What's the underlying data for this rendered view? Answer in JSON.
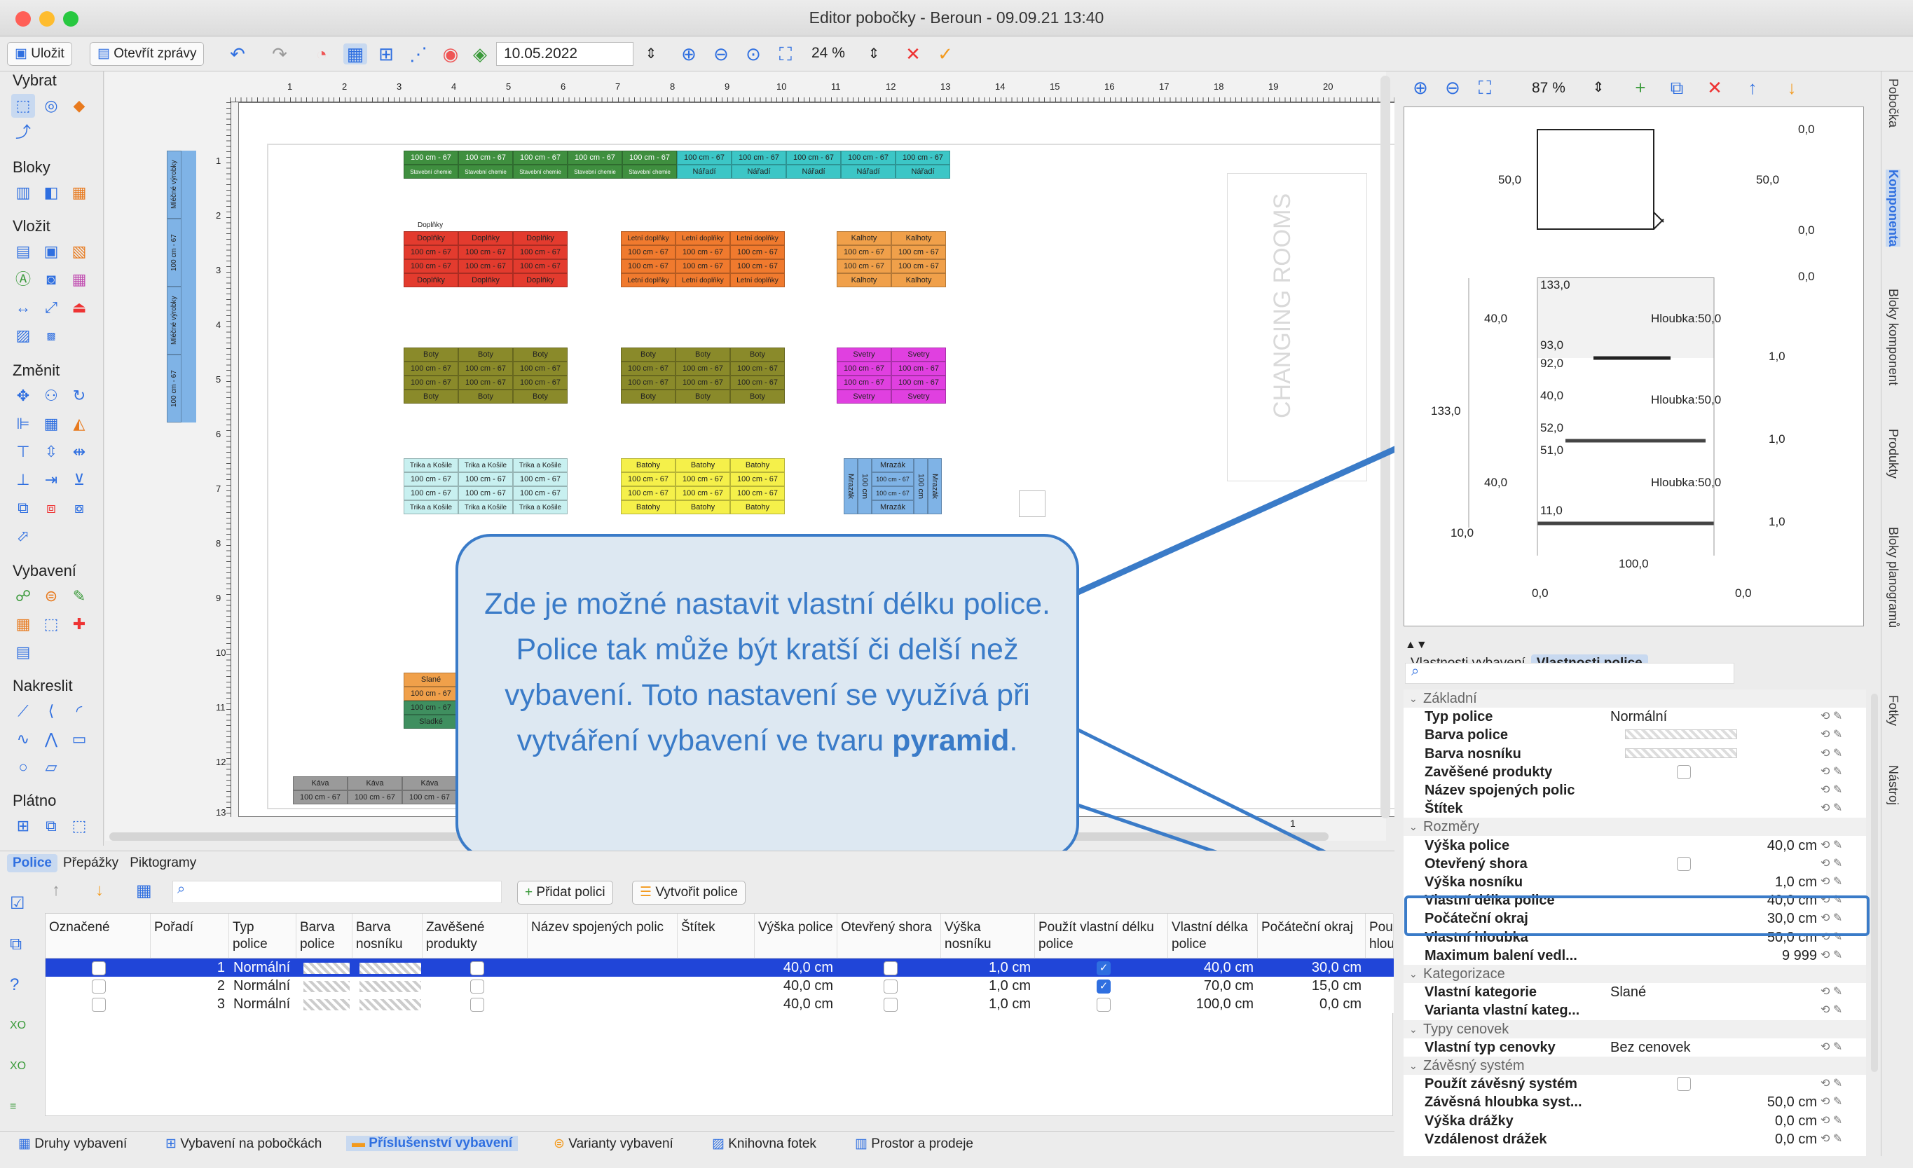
{
  "window": {
    "title": "Editor pobočky - Beroun - 09.09.21 13:40"
  },
  "toolbar": {
    "save_label": "Uložit",
    "open_reports_label": "Otevřít zprávy",
    "date": "10.05.2022",
    "zoom": "24 %"
  },
  "palette": {
    "sections": [
      "Vybrat",
      "Bloky",
      "Vložit",
      "Změnit",
      "Vybavení",
      "Nakreslit",
      "Plátno"
    ]
  },
  "canvas": {
    "ruler_top": [
      "1",
      "2",
      "3",
      "4",
      "5",
      "6",
      "7",
      "8",
      "9",
      "10",
      "11",
      "12",
      "13",
      "14",
      "15",
      "16",
      "17",
      "18",
      "19",
      "20"
    ],
    "ruler_left": [
      "1",
      "2",
      "3",
      "4",
      "5",
      "6",
      "7",
      "8",
      "9",
      "10",
      "11",
      "12",
      "13"
    ],
    "room_label": "CHANGING ROOMS",
    "page_number": "1",
    "blocks": {
      "milk": {
        "dim": "100 cm - 67",
        "name": "Mléčné výrobky"
      },
      "chem": {
        "dim": "100 cm - 67",
        "name": "Stavební chemie"
      },
      "naradi": {
        "dim": "100 cm - 67",
        "name": "Nářadí"
      },
      "doplnky": {
        "dim": "100 cm - 67",
        "name": "Doplňky",
        "header": "Doplňky"
      },
      "letni": {
        "dim": "100 cm - 67",
        "name": "Letní doplňky"
      },
      "kalhoty": {
        "dim": "100 cm - 67",
        "name": "Kalhoty"
      },
      "boty": {
        "dim": "100 cm - 67",
        "name": "Boty"
      },
      "boty2": {
        "dim": "100 cm - 67",
        "name": "Boty"
      },
      "svetry": {
        "dim": "100 cm - 67",
        "name": "Svetry"
      },
      "trika": {
        "dim": "100 cm - 67",
        "name": "Trika a Košile"
      },
      "batohy": {
        "dim": "100 cm - 67",
        "name": "Batohy"
      },
      "mrazak": {
        "dim": "100 cm - 67",
        "name": "Mrazák",
        "side_dim": "100 cm"
      },
      "slane": {
        "dim": "100 cm - 67",
        "top": "Slané",
        "bottom": "Sladké"
      },
      "kava": {
        "dim": "100 cm - 67",
        "name": "Káva"
      }
    }
  },
  "callout": {
    "text_before": "Zde je možné nastavit vlastní délku police. Police tak může být kratší či delší než vybavení. Toto nastavení se využívá při vytváření vybavení ve tvaru ",
    "text_bold": "pyramid",
    "text_after": "."
  },
  "right_toolbar": {
    "zoom": "87 %"
  },
  "preview": {
    "labels": [
      "0,0",
      "50,0",
      "50,0",
      "0,0",
      "0,0",
      "133,0",
      "40,0",
      "Hloubka:50,0",
      "93,0",
      "92,0",
      "1,0",
      "133,0",
      "40,0",
      "Hloubka:50,0",
      "52,0",
      "51,0",
      "1,0",
      "40,0",
      "Hloubka:50,0",
      "11,0",
      "1,0",
      "10,0",
      "100,0",
      "0,0",
      "0,0"
    ]
  },
  "props_tabs": [
    "Vlastnosti vybavení",
    "Vlastnosti police"
  ],
  "props": {
    "rows": [
      {
        "type": "group",
        "label": "Základní"
      },
      {
        "key": "Typ police",
        "value": "Normální"
      },
      {
        "key": "Barva police",
        "value": ""
      },
      {
        "key": "Barva nosníku",
        "value": ""
      },
      {
        "key": "Zavěšené produkty",
        "value": ""
      },
      {
        "key": "Název spojených polic",
        "value": ""
      },
      {
        "key": "Štítek",
        "value": ""
      },
      {
        "type": "group",
        "label": "Rozměry"
      },
      {
        "key": "Výška police",
        "value": "40,0 cm"
      },
      {
        "key": "Otevřený shora",
        "value": ""
      },
      {
        "key": "Výška nosníku",
        "value": "1,0 cm"
      },
      {
        "key": "Vlastní délka police",
        "value": "40,0 cm"
      },
      {
        "key": "Počáteční okraj",
        "value": "30,0 cm"
      },
      {
        "key": "Vlastní hloubka",
        "value": "50,0 cm"
      },
      {
        "key": "Maximum balení vedl...",
        "value": "9 999"
      },
      {
        "type": "group",
        "label": "Kategorizace"
      },
      {
        "key": "Vlastní kategorie",
        "value": "Slané"
      },
      {
        "key": "Varianta vlastní kateg...",
        "value": ""
      },
      {
        "type": "group",
        "label": "Typy cenovek"
      },
      {
        "key": "Vlastní typ cenovky",
        "value": "Bez cenovek"
      },
      {
        "type": "group",
        "label": "Závěsný systém"
      },
      {
        "key": "Použít závěsný systém",
        "value": ""
      },
      {
        "key": "Závěsná hloubka syst...",
        "value": "50,0 cm"
      },
      {
        "key": "Výška drážky",
        "value": "0,0 cm"
      },
      {
        "key": "Vzdálenost drážek",
        "value": "0,0 cm"
      }
    ]
  },
  "side_tabs": [
    "Pobočka",
    "Komponenta",
    "Bloky komponent",
    "Produkty",
    "Bloky planogramů",
    "Fotky",
    "Nástroj"
  ],
  "bottom": {
    "tabs": [
      "Police",
      "Přepážky",
      "Piktogramy"
    ],
    "add_shelf": "Přidat polici",
    "create_shelves": "Vytvořit police",
    "columns": [
      "Označené",
      "Pořadí",
      "Typ police",
      "Barva police",
      "Barva nosníku",
      "Zavěšené produkty",
      "Název spojených polic",
      "Štítek",
      "Výška police",
      "Otevřený shora",
      "Výška nosníku",
      "Použít vlastní délku police",
      "Vlastní délka police",
      "Počáteční okraj",
      "Použ hlou"
    ],
    "rows": [
      {
        "order": "1",
        "type": "Normální",
        "height": "40,0 cm",
        "beam": "1,0 cm",
        "length": "40,0 cm",
        "start": "30,0 cm"
      },
      {
        "order": "2",
        "type": "Normální",
        "height": "40,0 cm",
        "beam": "1,0 cm",
        "length": "70,0 cm",
        "start": "15,0 cm"
      },
      {
        "order": "3",
        "type": "Normální",
        "height": "40,0 cm",
        "beam": "1,0 cm",
        "length": "100,0 cm",
        "start": "0,0 cm"
      }
    ]
  },
  "taskbar": [
    "Druhy vybavení",
    "Vybavení na pobočkách",
    "Příslušenství vybavení",
    "Varianty vybavení",
    "Knihovna fotek",
    "Prostor a prodeje"
  ]
}
